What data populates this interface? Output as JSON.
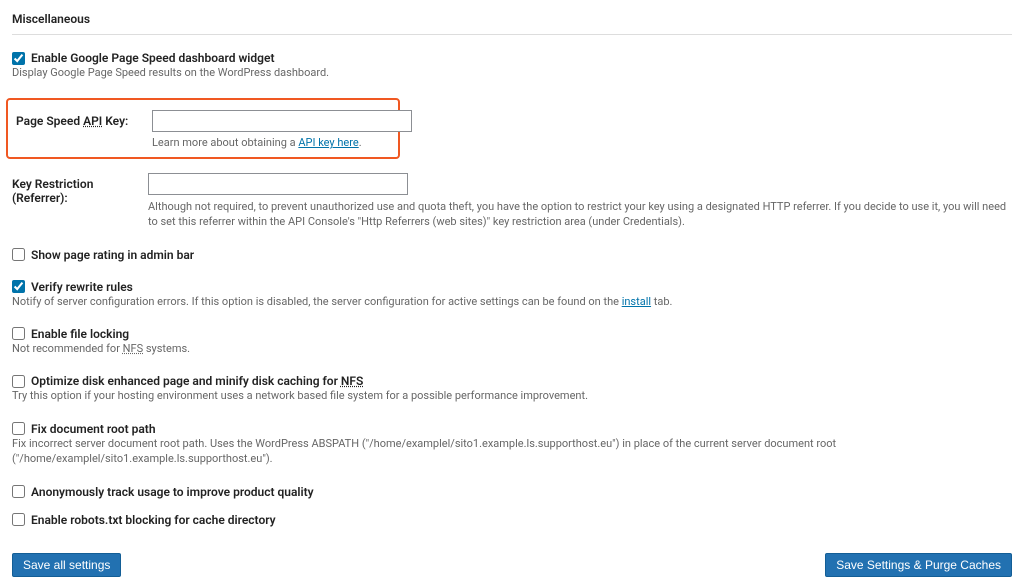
{
  "section": {
    "title": "Miscellaneous"
  },
  "enable_widget": {
    "label": "Enable Google Page Speed dashboard widget",
    "desc": "Display Google Page Speed results on the WordPress dashboard."
  },
  "api_key": {
    "label_pre": "Page Speed ",
    "label_abbr": "API",
    "label_post": " Key:",
    "help_pre": "Learn more about obtaining a ",
    "help_link": "API key here",
    "help_post": "."
  },
  "key_restriction": {
    "label": "Key Restriction (Referrer):",
    "desc": "Although not required, to prevent unauthorized use and quota theft, you have the option to restrict your key using a designated HTTP referrer. If you decide to use it, you will need to set this referrer within the API Console's \"Http Referrers (web sites)\" key restriction area (under Credentials)."
  },
  "show_rating": {
    "label": "Show page rating in admin bar"
  },
  "verify_rewrite": {
    "label": "Verify rewrite rules",
    "desc_pre": "Notify of server configuration errors. If this option is disabled, the server configuration for active settings can be found on the ",
    "desc_link": "install",
    "desc_post": " tab."
  },
  "file_locking": {
    "label": "Enable file locking",
    "desc_pre": "Not recommended for ",
    "desc_abbr": "NFS",
    "desc_post": " systems."
  },
  "optimize_disk": {
    "label_pre": "Optimize disk enhanced page and minify disk caching for ",
    "label_abbr": "NFS",
    "desc": "Try this option if your hosting environment uses a network based file system for a possible performance improvement."
  },
  "fix_doc_root": {
    "label": "Fix document root path",
    "desc": "Fix incorrect server document root path. Uses the WordPress ABSPATH (\"/home/examplel/sito1.example.ls.supporthost.eu\") in place of the current server document root (\"/home/examplel/sito1.example.ls.supporthost.eu\")."
  },
  "track_usage": {
    "label": "Anonymously track usage to improve product quality"
  },
  "robots_block": {
    "label": "Enable robots.txt blocking for cache directory"
  },
  "buttons": {
    "save": "Save all settings",
    "save_purge": "Save Settings & Purge Caches"
  }
}
